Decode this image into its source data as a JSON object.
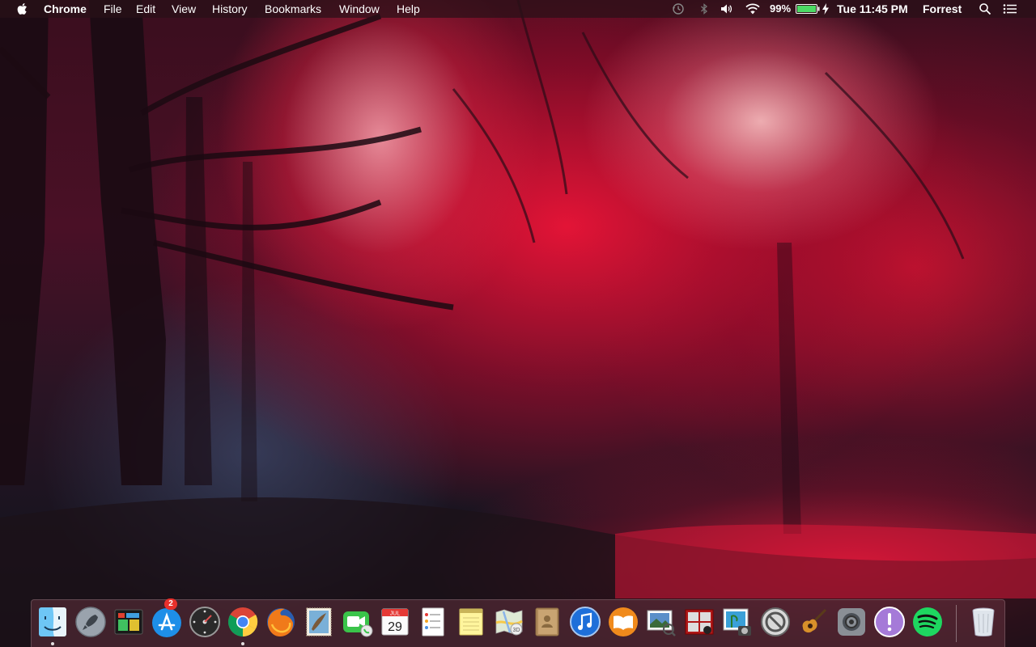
{
  "menubar": {
    "app_name": "Chrome",
    "menus": [
      "File",
      "Edit",
      "View",
      "History",
      "Bookmarks",
      "Window",
      "Help"
    ],
    "battery_percent": "99%",
    "clock": "Tue 11:45 PM",
    "user": "Forrest"
  },
  "status_icons": [
    "time-machine-icon",
    "bluetooth-icon",
    "volume-icon",
    "wifi-icon",
    "battery-icon",
    "charging-bolt-icon",
    "spotlight-search-icon",
    "notification-center-icon"
  ],
  "dock": {
    "items": [
      {
        "name": "finder",
        "running": true
      },
      {
        "name": "launchpad",
        "running": false
      },
      {
        "name": "activity-monitor",
        "running": false
      },
      {
        "name": "app-store",
        "running": false,
        "badge": "2"
      },
      {
        "name": "dashboard",
        "running": false
      },
      {
        "name": "chrome",
        "running": true
      },
      {
        "name": "firefox",
        "running": false
      },
      {
        "name": "mail",
        "running": false
      },
      {
        "name": "facetime",
        "running": false
      },
      {
        "name": "calendar",
        "running": false,
        "month": "JUL",
        "day": "29"
      },
      {
        "name": "reminders",
        "running": false
      },
      {
        "name": "notes",
        "running": false
      },
      {
        "name": "maps",
        "running": false
      },
      {
        "name": "contacts",
        "running": false
      },
      {
        "name": "itunes",
        "running": false
      },
      {
        "name": "ibooks",
        "running": false
      },
      {
        "name": "preview",
        "running": false
      },
      {
        "name": "photo-booth",
        "running": false
      },
      {
        "name": "image-capture",
        "running": false
      },
      {
        "name": "no-entry-app",
        "running": false
      },
      {
        "name": "garageband",
        "running": false
      },
      {
        "name": "system-preferences",
        "running": false
      },
      {
        "name": "feedback-assistant",
        "running": false
      },
      {
        "name": "spotify",
        "running": false
      },
      {
        "name": "trash",
        "running": false
      }
    ]
  },
  "colors": {
    "menubar_bg": "#2a1018",
    "badge": "#e8302c",
    "wallpaper_red": "#e8193c",
    "wallpaper_dark": "#1a1420"
  }
}
